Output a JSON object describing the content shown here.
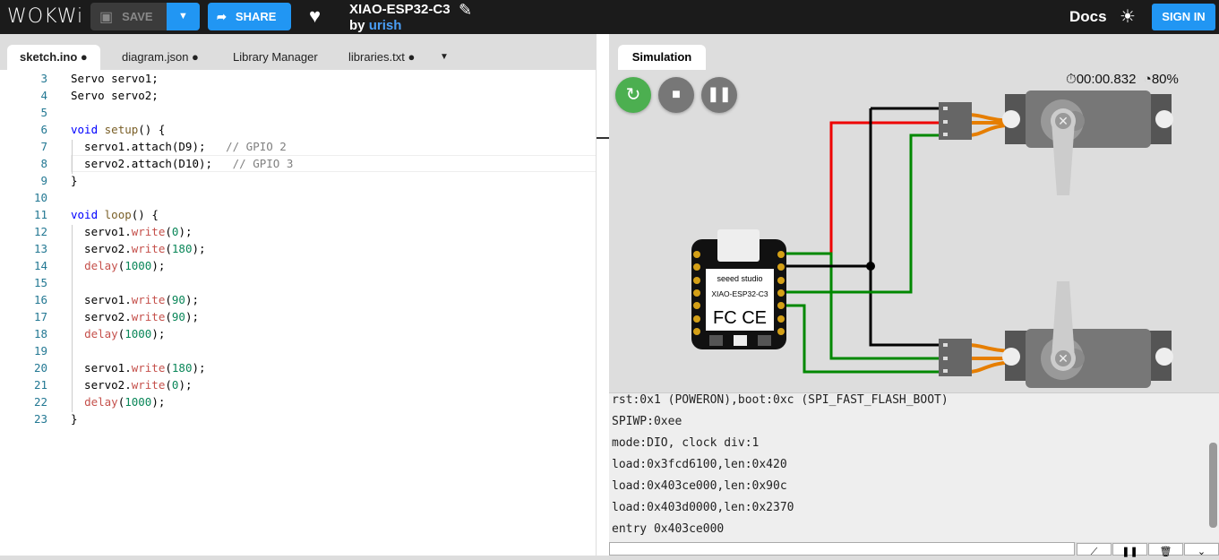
{
  "header": {
    "logo": "WOKWi",
    "save_label": "SAVE",
    "share_label": "SHARE",
    "project_title": "XIAO-ESP32-C3",
    "by_label": "by",
    "author": "urish",
    "docs_label": "Docs",
    "sign_in_label": "SIGN IN",
    "accent": "#2196f3"
  },
  "editor": {
    "tabs": [
      {
        "label": "sketch.ino ●",
        "active": true
      },
      {
        "label": "diagram.json ●"
      },
      {
        "label": "Library Manager"
      },
      {
        "label": "libraries.txt ●"
      }
    ],
    "lines": [
      {
        "n": "3",
        "t": "Servo servo1;"
      },
      {
        "n": "4",
        "t": "Servo servo2;"
      },
      {
        "n": "5",
        "t": ""
      },
      {
        "n": "6",
        "t": "void setup() {"
      },
      {
        "n": "7",
        "t": "  servo1.attach(D9);   // GPIO 2"
      },
      {
        "n": "8",
        "t": "  servo2.attach(D10);   // GPIO 3"
      },
      {
        "n": "9",
        "t": "}"
      },
      {
        "n": "10",
        "t": ""
      },
      {
        "n": "11",
        "t": "void loop() {"
      },
      {
        "n": "12",
        "t": "  servo1.write(0);"
      },
      {
        "n": "13",
        "t": "  servo2.write(180);"
      },
      {
        "n": "14",
        "t": "  delay(1000);"
      },
      {
        "n": "15",
        "t": ""
      },
      {
        "n": "16",
        "t": "  servo1.write(90);"
      },
      {
        "n": "17",
        "t": "  servo2.write(90);"
      },
      {
        "n": "18",
        "t": "  delay(1000);"
      },
      {
        "n": "19",
        "t": ""
      },
      {
        "n": "20",
        "t": "  servo1.write(180);"
      },
      {
        "n": "21",
        "t": "  servo2.write(0);"
      },
      {
        "n": "22",
        "t": "  delay(1000);"
      },
      {
        "n": "23",
        "t": "}"
      }
    ]
  },
  "simulation": {
    "tab_label": "Simulation",
    "timer": "00:00.832",
    "speed": "80%",
    "board_brand": "seeed studio",
    "board_name": "XIAO-ESP32-C3",
    "board_marks": "FC CE"
  },
  "serial": {
    "lines": [
      "rst:0x1 (POWERON),boot:0xc (SPI_FAST_FLASH_BOOT)",
      "SPIWP:0xee",
      "mode:DIO, clock div:1",
      "load:0x3fcd6100,len:0x420",
      "load:0x403ce000,len:0x90c",
      "load:0x403d0000,len:0x2370",
      "entry 0x403ce000"
    ]
  }
}
